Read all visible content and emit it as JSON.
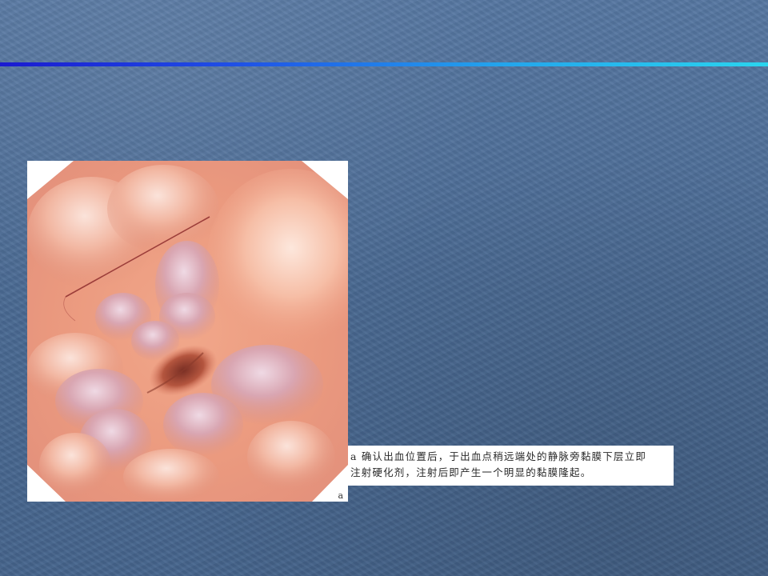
{
  "slide": {
    "accent_colors": {
      "background": "#4b6c95",
      "rule_start": "#1a1ad0",
      "rule_end": "#2ad4ee"
    }
  },
  "figure": {
    "image_subject": "endoscopic-view-illustration",
    "panel_letter": "a"
  },
  "caption": {
    "line1": "a 确认出血位置后，于出血点稍远端处的静脉旁黏膜下层立即",
    "line2": "注射硬化剂，注射后即产生一个明显的黏膜隆起。"
  }
}
